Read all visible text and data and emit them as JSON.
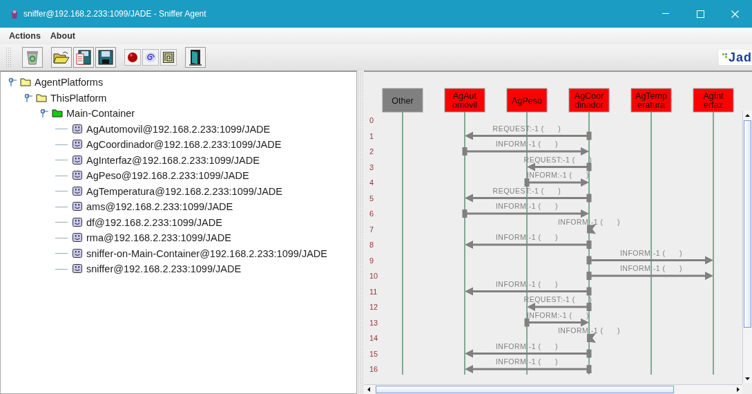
{
  "window": {
    "title": "sniffer@192.168.2.233:1099/JADE - Sniffer Agent"
  },
  "menu": [
    "Actions",
    "About"
  ],
  "logo": {
    "text": "Jad"
  },
  "tree": [
    {
      "label": "AgentPlatforms",
      "kind": "folder",
      "expanded": true,
      "children": [
        {
          "label": "ThisPlatform",
          "kind": "folder",
          "expanded": true,
          "children": [
            {
              "label": "Main-Container",
              "kind": "container",
              "expanded": true,
              "children": [
                {
                  "label": "AgAutomovil@192.168.2.233:1099/JADE",
                  "kind": "agent"
                },
                {
                  "label": "AgCoordinador@192.168.2.233:1099/JADE",
                  "kind": "agent"
                },
                {
                  "label": "AgInterfaz@192.168.2.233:1099/JADE",
                  "kind": "agent"
                },
                {
                  "label": "AgPeso@192.168.2.233:1099/JADE",
                  "kind": "agent"
                },
                {
                  "label": "AgTemperatura@192.168.2.233:1099/JADE",
                  "kind": "agent"
                },
                {
                  "label": "ams@192.168.2.233:1099/JADE",
                  "kind": "agent"
                },
                {
                  "label": "df@192.168.2.233:1099/JADE",
                  "kind": "agent"
                },
                {
                  "label": "rma@192.168.2.233:1099/JADE",
                  "kind": "agent"
                },
                {
                  "label": "sniffer-on-Main-Container@192.168.2.233:1099/JADE",
                  "kind": "agent"
                },
                {
                  "label": "sniffer@192.168.2.233:1099/JADE",
                  "kind": "agent"
                }
              ]
            }
          ]
        }
      ]
    }
  ],
  "diagram": {
    "agents": [
      {
        "lines": [
          "Other"
        ],
        "color": "#808080"
      },
      {
        "lines": [
          "AgAut",
          "omovil"
        ],
        "color": "#ff0000"
      },
      {
        "lines": [
          "AgPeso"
        ],
        "color": "#ff0000"
      },
      {
        "lines": [
          "AgCoor",
          "dinador"
        ],
        "color": "#ff0000"
      },
      {
        "lines": [
          "AgTemp",
          "eratura"
        ],
        "color": "#ff0000"
      },
      {
        "lines": [
          "AgInt",
          "erfaz"
        ],
        "color": "#ff0000"
      }
    ],
    "rows": [
      {
        "number": "0"
      },
      {
        "number": "1",
        "message": {
          "label": "REQUEST:-1 (      )",
          "lanes": [
            {
              "kind": "none"
            },
            {
              "kind": "target"
            },
            {
              "kind": "none"
            },
            {
              "kind": "source"
            },
            {
              "kind": "none"
            },
            {
              "kind": "none"
            }
          ]
        }
      },
      {
        "number": "2",
        "message": {
          "label": "INFORM:-1 (      )",
          "lanes": [
            {
              "kind": "none"
            },
            {
              "kind": "source"
            },
            {
              "kind": "none"
            },
            {
              "kind": "target"
            },
            {
              "kind": "none"
            },
            {
              "kind": "none"
            }
          ]
        }
      },
      {
        "number": "3",
        "message": {
          "label": "REQUEST:-1 (      )",
          "lanes": [
            {
              "kind": "none"
            },
            {
              "kind": "none"
            },
            {
              "kind": "target"
            },
            {
              "kind": "source"
            },
            {
              "kind": "none"
            },
            {
              "kind": "none"
            }
          ]
        }
      },
      {
        "number": "4",
        "message": {
          "label": "INFORM:-1 (      )",
          "lanes": [
            {
              "kind": "none"
            },
            {
              "kind": "none"
            },
            {
              "kind": "source"
            },
            {
              "kind": "target"
            },
            {
              "kind": "none"
            },
            {
              "kind": "none"
            }
          ]
        }
      },
      {
        "number": "5",
        "message": {
          "label": "REQUEST:-1 (      )",
          "lanes": [
            {
              "kind": "none"
            },
            {
              "kind": "target"
            },
            {
              "kind": "none"
            },
            {
              "kind": "source"
            },
            {
              "kind": "none"
            },
            {
              "kind": "none"
            }
          ]
        }
      },
      {
        "number": "6",
        "message": {
          "label": "INFORM:-1 (      )",
          "lanes": [
            {
              "kind": "none"
            },
            {
              "kind": "source"
            },
            {
              "kind": "none"
            },
            {
              "kind": "target"
            },
            {
              "kind": "none"
            },
            {
              "kind": "none"
            }
          ]
        }
      },
      {
        "number": "7",
        "message": {
          "label": "INFORM:-1 (      )",
          "lanes": [
            {
              "kind": "none"
            },
            {
              "kind": "none"
            },
            {
              "kind": "none"
            },
            {
              "kind": "self"
            },
            {
              "kind": "none"
            },
            {
              "kind": "none"
            }
          ]
        }
      },
      {
        "number": "8",
        "message": {
          "label": "INFORM:-1 (      )",
          "lanes": [
            {
              "kind": "none"
            },
            {
              "kind": "target"
            },
            {
              "kind": "none"
            },
            {
              "kind": "source"
            },
            {
              "kind": "none"
            },
            {
              "kind": "none"
            }
          ]
        }
      },
      {
        "number": "9",
        "message": {
          "label": "INFORM:-1 (      )",
          "lanes": [
            {
              "kind": "none"
            },
            {
              "kind": "none"
            },
            {
              "kind": "none"
            },
            {
              "kind": "source"
            },
            {
              "kind": "none"
            },
            {
              "kind": "target"
            }
          ]
        }
      },
      {
        "number": "10",
        "message": {
          "label": "INFORM:-1 (      )",
          "lanes": [
            {
              "kind": "none"
            },
            {
              "kind": "none"
            },
            {
              "kind": "none"
            },
            {
              "kind": "source"
            },
            {
              "kind": "none"
            },
            {
              "kind": "target"
            }
          ]
        }
      },
      {
        "number": "11",
        "message": {
          "label": "INFORM:-1 (      )",
          "lanes": [
            {
              "kind": "none"
            },
            {
              "kind": "target"
            },
            {
              "kind": "none"
            },
            {
              "kind": "source"
            },
            {
              "kind": "none"
            },
            {
              "kind": "none"
            }
          ]
        }
      },
      {
        "number": "12",
        "message": {
          "label": "REQUEST:-1 (      )",
          "lanes": [
            {
              "kind": "none"
            },
            {
              "kind": "none"
            },
            {
              "kind": "target"
            },
            {
              "kind": "source"
            },
            {
              "kind": "none"
            },
            {
              "kind": "none"
            }
          ]
        }
      },
      {
        "number": "13",
        "message": {
          "label": "INFORM:-1 (      )",
          "lanes": [
            {
              "kind": "none"
            },
            {
              "kind": "none"
            },
            {
              "kind": "source"
            },
            {
              "kind": "target"
            },
            {
              "kind": "none"
            },
            {
              "kind": "none"
            }
          ]
        }
      },
      {
        "number": "14",
        "message": {
          "label": "INFORM:-1 (      )",
          "lanes": [
            {
              "kind": "none"
            },
            {
              "kind": "none"
            },
            {
              "kind": "none"
            },
            {
              "kind": "self"
            },
            {
              "kind": "none"
            },
            {
              "kind": "none"
            }
          ]
        }
      },
      {
        "number": "15",
        "message": {
          "label": "INFORM:-1 (      )",
          "lanes": [
            {
              "kind": "none"
            },
            {
              "kind": "target"
            },
            {
              "kind": "none"
            },
            {
              "kind": "source"
            },
            {
              "kind": "none"
            },
            {
              "kind": "none"
            }
          ]
        }
      },
      {
        "number": "16",
        "message": {
          "label": "INFORM:-1 (      )",
          "lanes": [
            {
              "kind": "none"
            },
            {
              "kind": "target"
            },
            {
              "kind": "none"
            },
            {
              "kind": "source"
            },
            {
              "kind": "none"
            },
            {
              "kind": "none"
            }
          ]
        }
      }
    ]
  }
}
